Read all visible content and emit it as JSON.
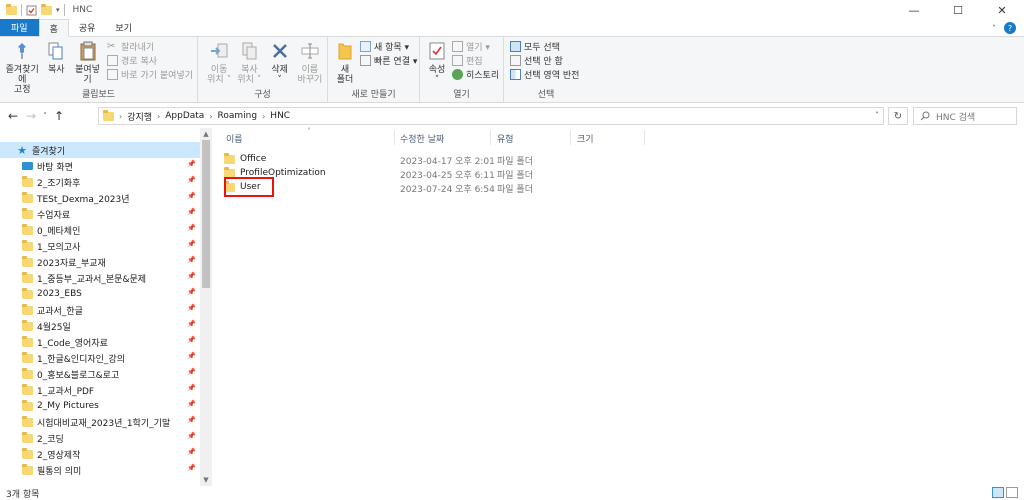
{
  "window": {
    "title": "HNC",
    "controls": {
      "minimize": "—",
      "maximize": "☐",
      "close": "✕"
    }
  },
  "tabs": {
    "file": "파일",
    "home": "홈",
    "share": "공유",
    "view": "보기"
  },
  "ribbon": {
    "clipboard": {
      "pin_quick": "즐겨찾기에\n고정",
      "copy": "복사",
      "paste": "붙여넣기",
      "cut": "잘라내기",
      "copy_path": "경로 복사",
      "paste_shortcut": "바로 가기 붙여넣기",
      "label": "클립보드"
    },
    "organize": {
      "move_to": "이동\n위치 ˅",
      "copy_to": "복사\n위치 ˅",
      "delete": "삭제\n˅",
      "rename": "이름\n바꾸기",
      "label": "구성"
    },
    "new": {
      "new_folder": "새\n폴더",
      "new_item": "새 항목 ▾",
      "easy_access": "빠른 연결 ▾",
      "label": "새로 만들기"
    },
    "open": {
      "properties": "속성\n˅",
      "open": "열기 ▾",
      "edit": "편집",
      "history": "히스토리",
      "label": "열기"
    },
    "select": {
      "select_all": "모두 선택",
      "select_none": "선택 안 함",
      "invert": "선택 영역 반전",
      "label": "선택"
    }
  },
  "address": {
    "crumbs": [
      "강지행",
      "AppData",
      "Roaming",
      "HNC"
    ],
    "search_placeholder": "HNC 검색"
  },
  "nav": {
    "quick_access": "즐겨찾기",
    "items": [
      "바탕 화면",
      "2_조기화후",
      "TESt_Dexma_2023년",
      "수업자료",
      "0_메타체인",
      "1_모의고사",
      "2023자료_부교재",
      "1_중등부_교과서_본문&문제",
      "2023_EBS",
      "교과서_한글",
      "4월25일",
      "1_Code_영어자료",
      "1_한글&인디자인_강의",
      "0_홍보&블로그&로고",
      "1_교과서_PDF",
      "2_My Pictures",
      "시험대비교재_2023년_1학기_기말",
      "2_코딩",
      "2_영상제작",
      "필통의 의미"
    ]
  },
  "columns": {
    "name": "이름",
    "modified": "수정한 날짜",
    "type": "유형",
    "size": "크기"
  },
  "files": [
    {
      "name": "Office",
      "modified": "2023-04-17 오후 2:01",
      "type": "파일 폴더"
    },
    {
      "name": "ProfileOptimization",
      "modified": "2023-04-25 오후 6:11",
      "type": "파일 폴더"
    },
    {
      "name": "User",
      "modified": "2023-07-24 오후 6:54",
      "type": "파일 폴더"
    }
  ],
  "status": {
    "count": "3개 항목"
  },
  "colors": {
    "accent": "#1979ca",
    "selection": "#cce8ff",
    "highlight_box": "#ee1111",
    "folder": "#f8d775"
  }
}
